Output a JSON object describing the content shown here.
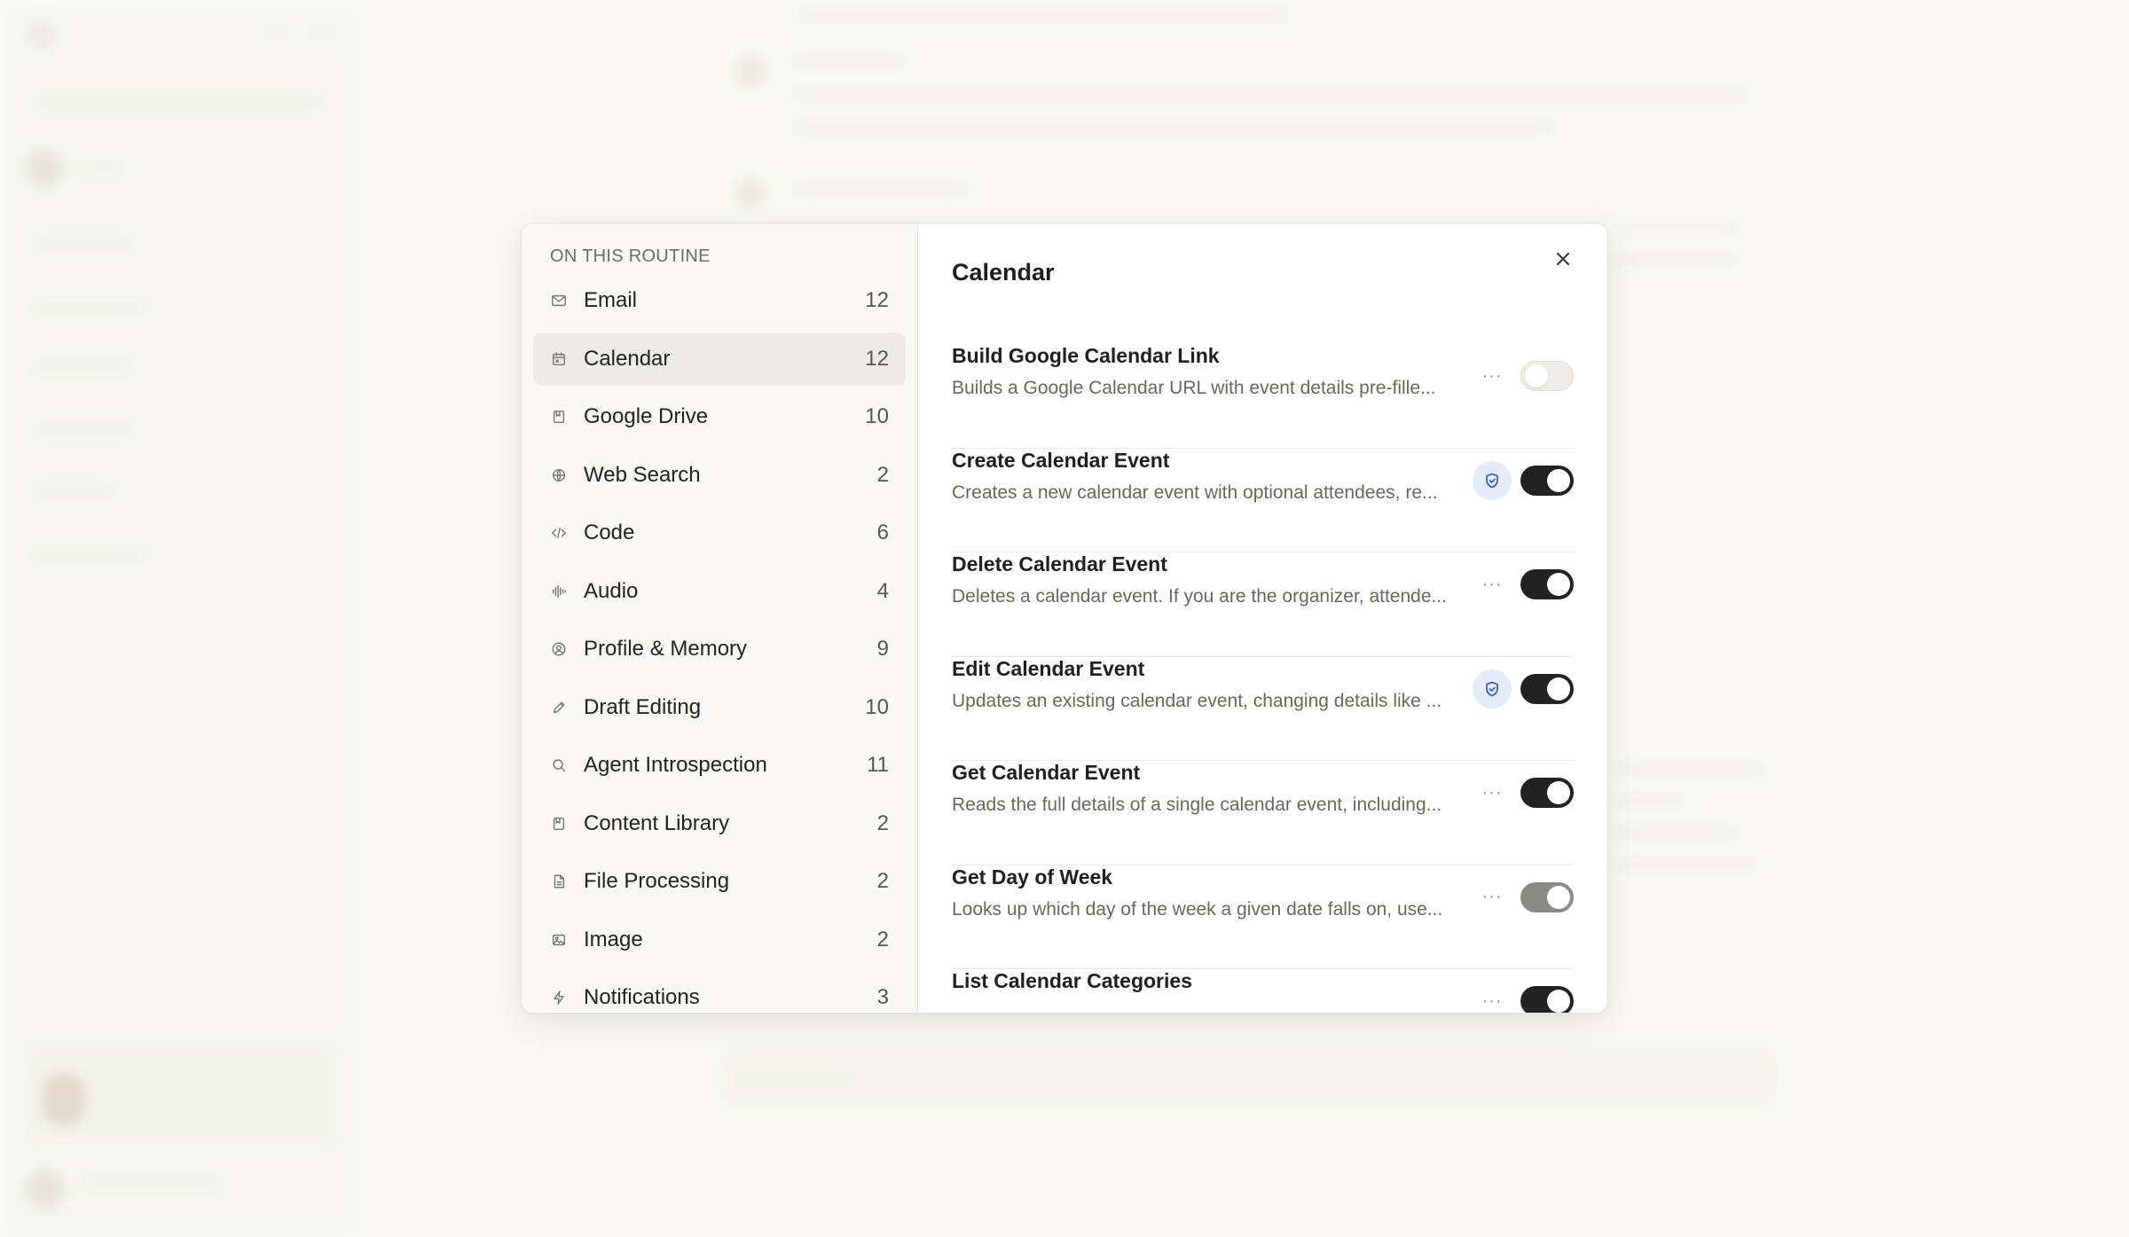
{
  "modal": {
    "section_heading": "ON THIS ROUTINE",
    "categories": [
      {
        "label": "Email",
        "count": "12",
        "icon": "mail-icon"
      },
      {
        "label": "Calendar",
        "count": "12",
        "icon": "calendar-icon",
        "active": true
      },
      {
        "label": "Google Drive",
        "count": "10",
        "icon": "drive-icon"
      },
      {
        "label": "Web Search",
        "count": "2",
        "icon": "globe-icon"
      },
      {
        "label": "Code",
        "count": "6",
        "icon": "code-icon"
      },
      {
        "label": "Audio",
        "count": "4",
        "icon": "audio-icon"
      },
      {
        "label": "Profile & Memory",
        "count": "9",
        "icon": "profile-icon"
      },
      {
        "label": "Draft Editing",
        "count": "10",
        "icon": "pencil-icon"
      },
      {
        "label": "Agent Introspection",
        "count": "11",
        "icon": "search-icon"
      },
      {
        "label": "Content Library",
        "count": "2",
        "icon": "bookmark-icon"
      },
      {
        "label": "File Processing",
        "count": "2",
        "icon": "file-icon"
      },
      {
        "label": "Image",
        "count": "2",
        "icon": "image-icon"
      },
      {
        "label": "Notifications",
        "count": "3",
        "icon": "bolt-icon"
      }
    ],
    "panel_title": "Calendar",
    "tools": [
      {
        "name": "Build Google Calendar Link",
        "desc": "Builds a Google Calendar URL with event details pre-fille...",
        "action": "more",
        "toggle": "off"
      },
      {
        "name": "Create Calendar Event",
        "desc": "Creates a new calendar event with optional attendees, re...",
        "action": "shield",
        "toggle": "on"
      },
      {
        "name": "Delete Calendar Event",
        "desc": "Deletes a calendar event. If you are the organizer, attende...",
        "action": "more",
        "toggle": "on"
      },
      {
        "name": "Edit Calendar Event",
        "desc": "Updates an existing calendar event, changing details like ...",
        "action": "shield",
        "toggle": "on"
      },
      {
        "name": "Get Calendar Event",
        "desc": "Reads the full details of a single calendar event, including...",
        "action": "more",
        "toggle": "on"
      },
      {
        "name": "Get Day of Week",
        "desc": "Looks up which day of the week a given date falls on, use...",
        "action": "more",
        "toggle": "dim"
      },
      {
        "name": "List Calendar Categories",
        "desc": "",
        "action": "more",
        "toggle": "on"
      }
    ],
    "more_glyph": "···"
  }
}
